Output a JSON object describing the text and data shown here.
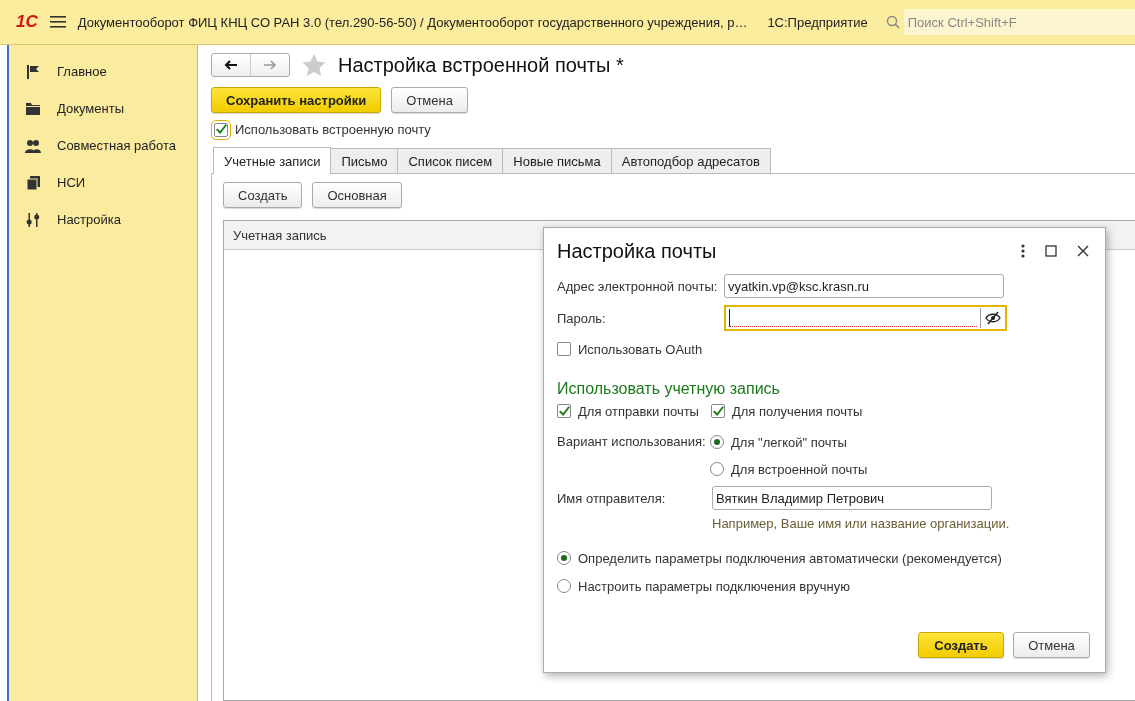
{
  "app_bar": {
    "logo": "1С",
    "title": "Документооборот ФИЦ КНЦ СО РАН 3.0 (тел.290-56-50) / Документооборот государственного учреждения, р…",
    "product": "1С:Предприятие",
    "search": {
      "placeholder": "Поиск Ctrl+Shift+F"
    }
  },
  "sidebar": {
    "items": [
      {
        "label": "Главное"
      },
      {
        "label": "Документы"
      },
      {
        "label": "Совместная работа"
      },
      {
        "label": "НСИ"
      },
      {
        "label": "Настройка"
      }
    ]
  },
  "form": {
    "title": "Настройка встроенной почты *",
    "save_button": "Сохранить настройки",
    "cancel_button": "Отмена",
    "use_mail": {
      "label": "Использовать встроенную почту",
      "checked": true
    },
    "tabs": [
      {
        "label": "Учетные записи",
        "selected": true
      },
      {
        "label": "Письмо",
        "selected": false
      },
      {
        "label": "Список писем",
        "selected": false
      },
      {
        "label": "Новые письма",
        "selected": false
      },
      {
        "label": "Автоподбор адресатов",
        "selected": false
      }
    ],
    "toolbar": [
      "Создать",
      "Основная"
    ],
    "table": {
      "columns": [
        "Учетная запись"
      ]
    }
  },
  "dialog": {
    "title": "Настройка почты",
    "email": {
      "label": "Адрес электронной почты:",
      "value": "vyatkin.vp@ksc.krasn.ru"
    },
    "password": {
      "label": "Пароль:",
      "focused": true
    },
    "oauth": {
      "label": "Использовать OAuth",
      "checked": false
    },
    "section_title": "Использовать учетную запись",
    "usage_checks": [
      {
        "label": "Для отправки почты",
        "checked": true
      },
      {
        "label": "Для получения почты",
        "checked": true
      }
    ],
    "variant": {
      "label": "Вариант использования:",
      "options": [
        {
          "label": "Для \"легкой\" почты",
          "selected": true
        },
        {
          "label": "Для встроенной почты",
          "selected": false
        }
      ]
    },
    "sender": {
      "label": "Имя отправителя:",
      "value": "Вяткин Владимир Петрович",
      "hint": "Например, Ваше имя или название организации."
    },
    "connection": [
      {
        "label": "Определить параметры подключения автоматически (рекомендуется)",
        "selected": true
      },
      {
        "label": "Настроить параметры подключения вручную",
        "selected": false
      }
    ],
    "create_button": "Создать",
    "cancel_button": "Отмена"
  }
}
